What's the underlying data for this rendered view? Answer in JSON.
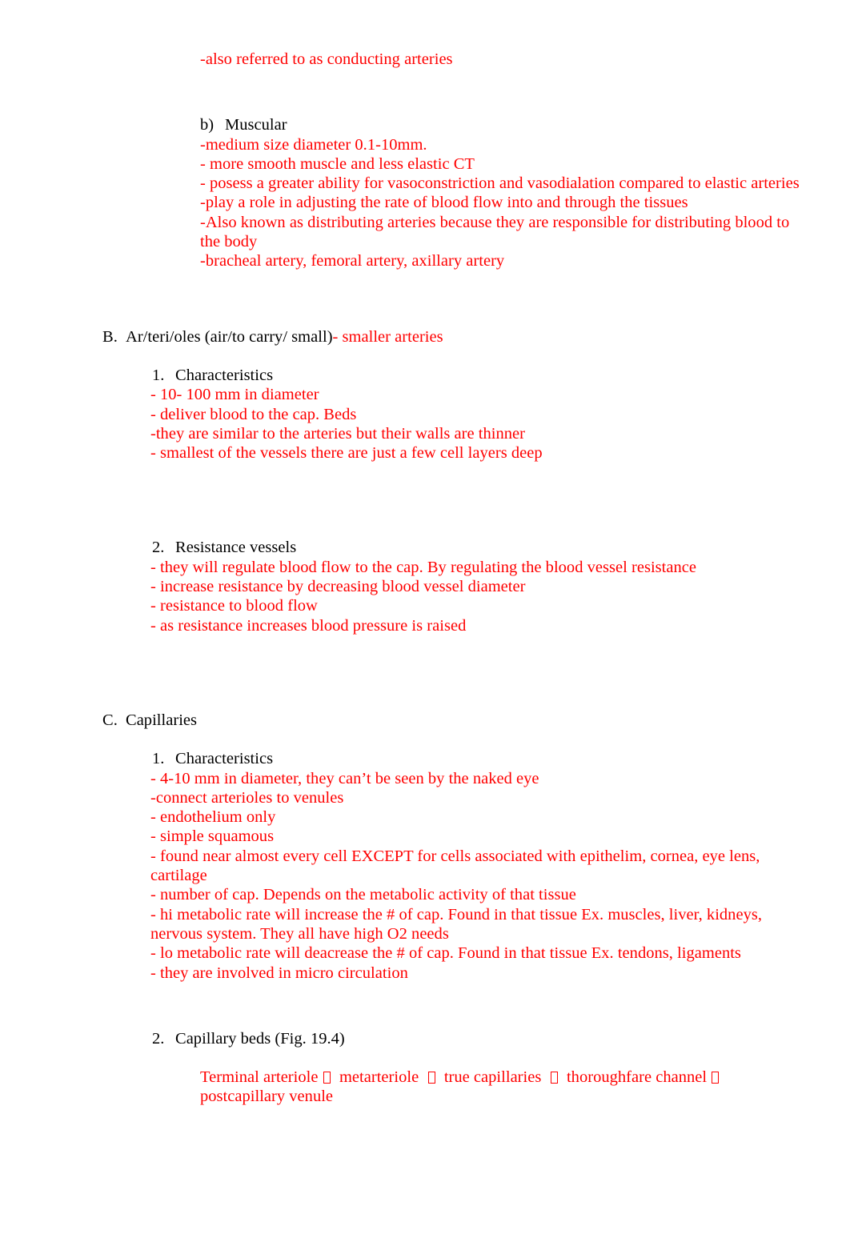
{
  "document": {
    "text_colors": {
      "body_red": "#ff0000",
      "heading_black": "#000000",
      "page_background": "#ffffff"
    },
    "blocks": {
      "elastic_note": "-also referred to as conducting arteries",
      "muscular_marker": "b)",
      "muscular_label": "Muscular",
      "muscular_lines": [
        "-medium size diameter 0.1-10mm.",
        "- more smooth muscle and less elastic CT",
        "- posess a greater ability for vasoconstriction and vasodialation compared to elastic arteries",
        "-play a role in adjusting the rate of blood flow into and through the tissues",
        "-Also known as distributing arteries because they are responsible for distributing blood to the body",
        "-bracheal artery, femoral artery, axillary artery"
      ],
      "arterioles_marker": "B.",
      "arterioles_heading_black": "Ar/teri/oles (air/to carry/ small)",
      "arterioles_heading_red": "- smaller arteries",
      "arterioles_char_marker": "1.",
      "arterioles_char_label": "Characteristics",
      "arterioles_char_lines": [
        "- 10- 100 mm in diameter",
        "- deliver blood to the cap. Beds",
        "-they are similar to the arteries but their walls are thinner",
        "- smallest of the vessels there are just a few cell layers deep"
      ],
      "resistance_marker": "2.",
      "resistance_label": "Resistance vessels",
      "resistance_lines": [
        "- they will regulate blood flow to the cap. By regulating the blood vessel resistance",
        "- increase resistance by decreasing blood vessel diameter",
        "- resistance to blood flow",
        "- as resistance increases blood pressure is raised"
      ],
      "capillaries_marker": "C.",
      "capillaries_label": "Capillaries",
      "capillaries_char_marker": "1.",
      "capillaries_char_label": "Characteristics",
      "capillaries_char_lines": [
        "- 4-10 mm in diameter, they can’t be seen by the naked eye",
        "-connect arterioles to venules",
        "- endothelium only",
        "- simple squamous",
        "- found near almost every cell EXCEPT for cells associated with epithelim, cornea, eye lens, cartilage",
        "- number of cap. Depends on the metabolic activity of that tissue",
        "- hi metabolic rate will increase the # of cap. Found in that tissue Ex. muscles, liver, kidneys, nervous system. They all have high O2 needs",
        "- lo metabolic rate will deacrease the # of cap. Found in that tissue Ex. tendons, ligaments",
        "- they are involved in micro circulation"
      ],
      "capbeds_marker": "2.",
      "capbeds_label": "Capillary beds (Fig. 19.4)",
      "capbeds_flow": {
        "step_1": "Terminal arteriole",
        "step_2": "metarteriole",
        "step_3": "true capillaries",
        "step_4": "thoroughfare channel",
        "step_5": "postcapillary venule",
        "separator_glyph": "missing-glyph-box"
      }
    }
  }
}
